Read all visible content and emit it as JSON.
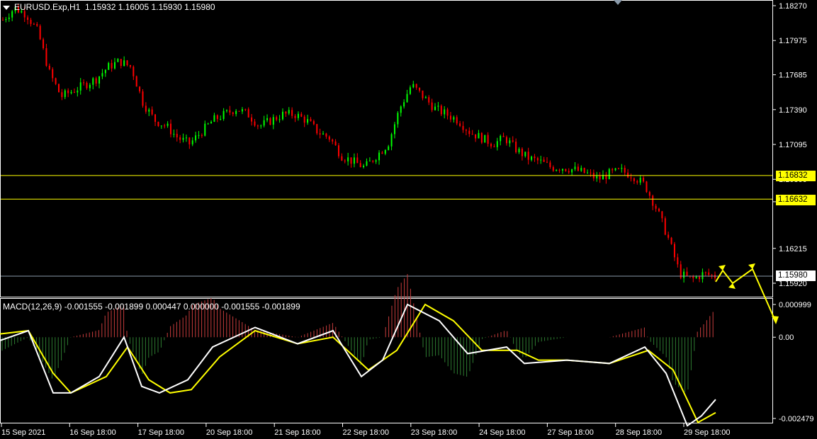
{
  "header": {
    "symbol_timeframe": "EURUSD.Exp,H1",
    "ohlc": "1.15932 1.16005 1.15930 1.15980"
  },
  "price_axis": {
    "ticks": [
      "1.18270",
      "1.17975",
      "1.17685",
      "1.17390",
      "1.17095",
      "1.16800",
      "1.16610",
      "1.16215",
      "1.15920"
    ],
    "tick_values": [
      1.1827,
      1.17975,
      1.17685,
      1.1739,
      1.17095,
      1.168,
      1.1661,
      1.16215,
      1.1592
    ]
  },
  "levels": {
    "resistance_1": {
      "label": "1.16832",
      "value": 1.16832,
      "color": "#ffff00"
    },
    "resistance_2": {
      "label": "1.16632",
      "value": 1.16632,
      "color": "#ffff00"
    },
    "current_price": {
      "label": "1.15980",
      "value": 1.1598,
      "color": "#ffffff"
    }
  },
  "macd": {
    "label": "MACD(12,26,9) -0.001555 -0.001899 0.000447 0.000000 -0.001555 -0.001899",
    "axis_ticks": [
      "0.000999",
      "0.00",
      "-0.002479"
    ],
    "axis_values": [
      0.000999,
      0.0,
      -0.002479
    ]
  },
  "time_axis": {
    "labels": [
      "15 Sep 2021",
      "16 Sep 18:00",
      "17 Sep 18:00",
      "20 Sep 18:00",
      "21 Sep 18:00",
      "22 Sep 18:00",
      "23 Sep 18:00",
      "24 Sep 18:00",
      "27 Sep 18:00",
      "28 Sep 18:00",
      "29 Sep 18:00"
    ]
  },
  "colors": {
    "bull": "#00ff00",
    "bear": "#ff0000",
    "histogram_positive": "#c83c3c",
    "histogram_negative": "#2e7d32",
    "macd_line": "#ffffff",
    "signal_line": "#ffff00",
    "forecast_arrow": "#ffff00",
    "axis": "#ffffff"
  },
  "chart_data": {
    "type": "candlestick",
    "close_path": [
      1.1815,
      1.1825,
      1.182,
      1.1805,
      1.177,
      1.175,
      1.1755,
      1.176,
      1.1765,
      1.1775,
      1.178,
      1.1775,
      1.1745,
      1.173,
      1.1725,
      1.1715,
      1.171,
      1.172,
      1.173,
      1.1735,
      1.174,
      1.1735,
      1.1725,
      1.173,
      1.1735,
      1.1735,
      1.173,
      1.172,
      1.1715,
      1.17,
      1.1695,
      1.169,
      1.17,
      1.171,
      1.174,
      1.176,
      1.175,
      1.174,
      1.1735,
      1.173,
      1.172,
      1.1715,
      1.171,
      1.1715,
      1.1705,
      1.1698,
      1.1695,
      1.169,
      1.169,
      1.1688,
      1.1685,
      1.168,
      1.1685,
      1.1687,
      1.1683,
      1.1675,
      1.1655,
      1.163,
      1.16,
      1.1595,
      1.16,
      1.1598
    ]
  }
}
